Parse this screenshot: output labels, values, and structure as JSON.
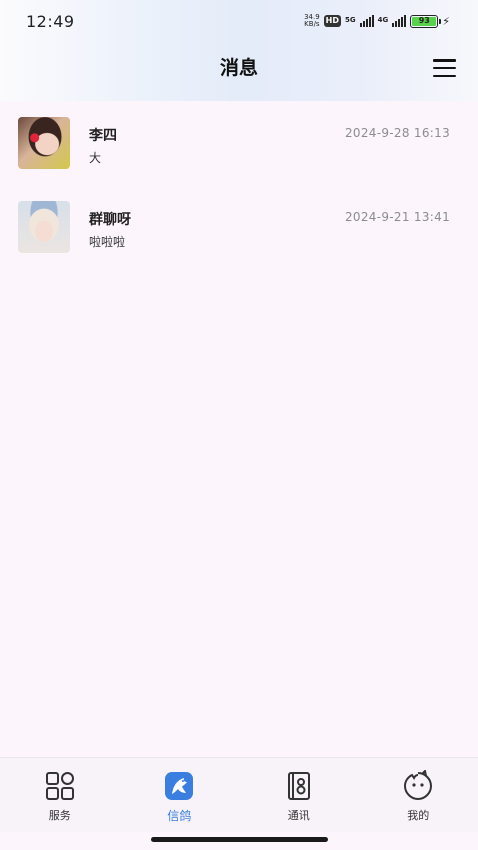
{
  "status_bar": {
    "time": "12:49",
    "speed_value": "34.9",
    "speed_unit": "KB/s",
    "hd": "HD",
    "net1": "5G",
    "net2": "4G",
    "battery": "93"
  },
  "header": {
    "title": "消息",
    "menu_icon": "hamburger-menu-icon"
  },
  "chats": [
    {
      "name": "李四",
      "last_message": "大",
      "time": "2024-9-28 16:13"
    },
    {
      "name": "群聊呀",
      "last_message": "啦啦啦",
      "time": "2024-9-21 13:41"
    }
  ],
  "tabs": [
    {
      "label": "服务",
      "icon": "grid-icon",
      "active": false
    },
    {
      "label": "信鸽",
      "icon": "pigeon-icon",
      "active": true
    },
    {
      "label": "通讯",
      "icon": "contacts-book-icon",
      "active": false
    },
    {
      "label": "我的",
      "icon": "smiley-icon",
      "active": false
    }
  ],
  "colors": {
    "accent": "#3a7ee0",
    "background": "#fcf6fc",
    "time_text": "#8c8c8c"
  }
}
